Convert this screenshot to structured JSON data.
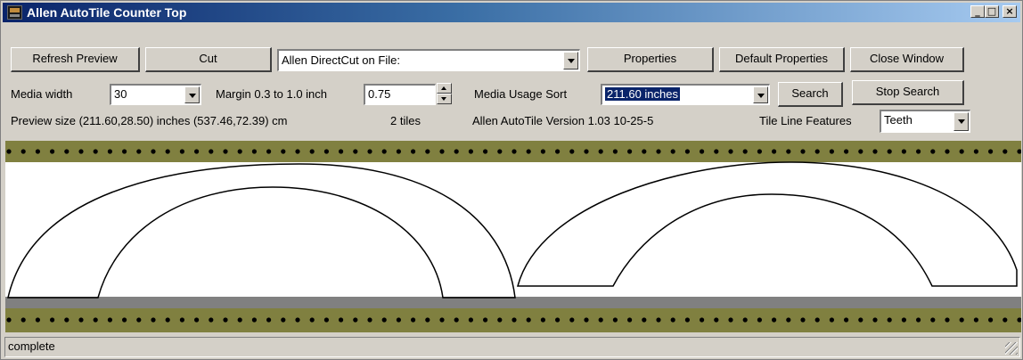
{
  "window": {
    "title": "Allen AutoTile Counter Top"
  },
  "titlebar_buttons": {
    "minimize": "_",
    "maximize": "□",
    "close": "×"
  },
  "toolbar": {
    "refresh_label": "Refresh Preview",
    "cut_label": "Cut",
    "output_select_value": "Allen DirectCut on File:",
    "properties_label": "Properties",
    "default_properties_label": "Default Properties",
    "close_window_label": "Close Window"
  },
  "controls": {
    "media_width_label": "Media width",
    "media_width_value": "30",
    "margin_label": "Margin 0.3 to 1.0 inch",
    "margin_value": "0.75",
    "media_usage_sort_label": "Media Usage Sort",
    "media_usage_sort_value": "211.60 inches",
    "search_label": "Search",
    "stop_search_label": "Stop Search"
  },
  "info": {
    "preview_size": "Preview size (211.60,28.50) inches  (537.46,72.39) cm",
    "tiles": "2 tiles",
    "version": "Allen AutoTile Version 1.03 10-25-5",
    "tile_line_features_label": "Tile Line Features",
    "tile_line_features_value": "Teeth"
  },
  "status": {
    "text": "complete"
  },
  "colors": {
    "media_band": "#808040",
    "band_dots": "#000000",
    "title_start": "#0a246a"
  }
}
